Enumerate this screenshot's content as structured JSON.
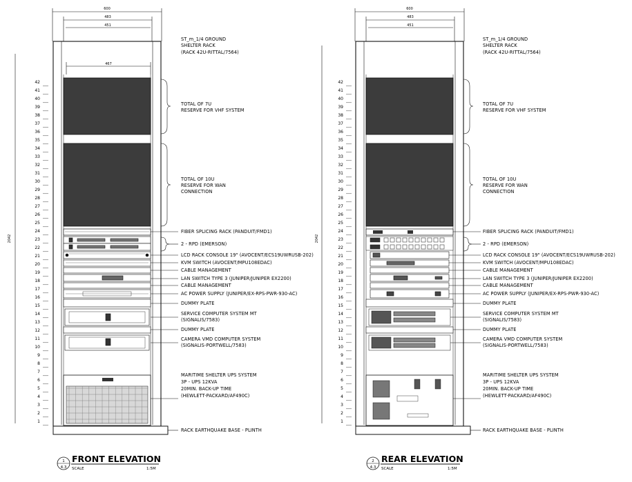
{
  "dimensions": {
    "overall": "600",
    "inner": "483",
    "rail": "451",
    "equipment": "467",
    "height": "2042"
  },
  "units": [
    "1",
    "2",
    "3",
    "4",
    "5",
    "6",
    "7",
    "8",
    "9",
    "10",
    "11",
    "12",
    "13",
    "14",
    "15",
    "16",
    "17",
    "18",
    "19",
    "20",
    "21",
    "22",
    "23",
    "24",
    "25",
    "26",
    "27",
    "28",
    "29",
    "30",
    "31",
    "32",
    "33",
    "34",
    "35",
    "36",
    "37",
    "38",
    "39",
    "40",
    "41",
    "42"
  ],
  "labels": {
    "rack_title_1": "ST_m_1/4 GROUND",
    "rack_title_2": "SHELTER RACK",
    "rack_title_3": "(RACK 42U-RITTAL/7564)",
    "vhf_1": "TOTAL OF 7U",
    "vhf_2": "RESERVE FOR VHF SYSTEM",
    "wan_1": "TOTAL OF 10U",
    "wan_2": "RESERVE FOR WAN",
    "wan_3": "CONNECTION",
    "fiber": "FIBER SPLICING RACK (PANDUIT/FMD1)",
    "rpd": "2 - RPD (EMERSON)",
    "lcd": "LCD RACK CONSOLE 19\" (AVOCENT/ECS19UWRUSB-202)",
    "kvm": "KVM SWITCH (AVOCENT/MPU108EDAC)",
    "cable1": "CABLE MANAGEMENT",
    "lan": "LAN SWITCH TYPE 3 (JUNIPER/JUNIPER EX2200)",
    "cable2": "CABLE MANAGEMENT",
    "ac": "AC POWER SUPPLY (JUNIPER/EX-RPS-PWR-930-AC)",
    "dummy1": "DUMMY PLATE",
    "svc_1": "SERVICE COMPUTER SYSTEM MT",
    "svc_2": "(SIGNALIS/7583)",
    "dummy2": "DUMMY PLATE",
    "cam_1": "CAMERA VMD COMPUTER SYSTEM",
    "cam_2": "(SIGNALIS-PORTWELL/7583)",
    "ups_1": "MARITIME SHELTER UPS SYSTEM",
    "ups_2": "3P - UPS 12KVA",
    "ups_3": "20MIN. BACK-UP TIME",
    "ups_4": "(HEWLETT-PACKARD/AF490C)",
    "base": "RACK EARTHQUAKE BASE - PLINTH"
  },
  "views": [
    {
      "title": "FRONT ELEVATION",
      "number": "1",
      "sheet": "4.3",
      "scale_label": "SCALE",
      "scale": "1:5M"
    },
    {
      "title": "REAR ELEVATION",
      "number": "2",
      "sheet": "4.3",
      "scale_label": "SCALE",
      "scale": "1:5M"
    }
  ],
  "colors": {
    "reserve_fill": "#3c3c3c",
    "line": "#111111",
    "ups_grille": "#d8d8d8"
  }
}
